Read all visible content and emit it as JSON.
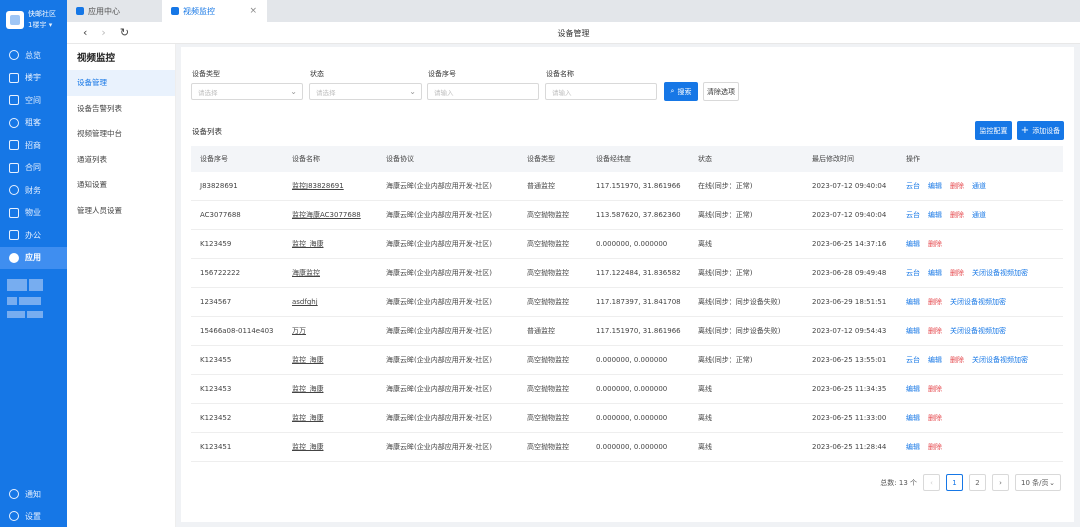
{
  "org": {
    "name": "快邮社区",
    "sub": "1楼宇"
  },
  "nav": [
    {
      "label": "总览",
      "icon": "clock-icon"
    },
    {
      "label": "楼宇",
      "icon": "building-icon"
    },
    {
      "label": "空间",
      "icon": "cube-icon"
    },
    {
      "label": "租客",
      "icon": "people-icon"
    },
    {
      "label": "招商",
      "icon": "target-icon"
    },
    {
      "label": "合同",
      "icon": "document-icon"
    },
    {
      "label": "财务",
      "icon": "money-icon"
    },
    {
      "label": "物业",
      "icon": "home-icon"
    },
    {
      "label": "办公",
      "icon": "monitor-icon"
    },
    {
      "label": "应用",
      "icon": "apps-icon"
    }
  ],
  "nav_bottom": [
    {
      "label": "通知",
      "icon": "bell-icon"
    },
    {
      "label": "设置",
      "icon": "menu-icon"
    }
  ],
  "tabs": [
    {
      "label": "应用中心"
    },
    {
      "label": "视频监控"
    }
  ],
  "titlebar": {
    "title": "设备管理"
  },
  "subnav": {
    "title": "视频监控",
    "items": [
      "设备管理",
      "设备告警列表",
      "视频管理中台",
      "通道列表",
      "通知设置",
      "管理人员设置"
    ]
  },
  "filters": {
    "type_label": "设备类型",
    "type_placeholder": "请选择",
    "status_label": "状态",
    "status_placeholder": "请选择",
    "serial_label": "设备序号",
    "serial_placeholder": "请输入",
    "name_label": "设备名称",
    "name_placeholder": "请输入",
    "search_btn": "搜索",
    "clear_btn": "清除选项"
  },
  "list": {
    "title": "设备列表",
    "config_btn": "监控配置",
    "add_btn": "添加设备"
  },
  "table": {
    "columns": [
      "设备序号",
      "设备名称",
      "设备协议",
      "设备类型",
      "设备经纬度",
      "状态",
      "最后修改时间",
      "操作"
    ],
    "rows": [
      {
        "serial": "J83828691",
        "name": "监控J83828691",
        "protocol": "海康云眸(企业内部应用开发-社区)",
        "type": "普通监控",
        "coords": "117.151970, 31.861966",
        "status": "在线(同步：正常)",
        "time": "2023-07-12 09:40:04",
        "ops": [
          "云台",
          "编辑",
          "删除",
          "通道"
        ]
      },
      {
        "serial": "AC3077688",
        "name": "监控海康AC3077688",
        "protocol": "海康云眸(企业内部应用开发-社区)",
        "type": "高空抛物监控",
        "coords": "113.587620, 37.862360",
        "status": "离线(同步：正常)",
        "time": "2023-07-12 09:40:04",
        "ops": [
          "云台",
          "编辑",
          "删除",
          "通道"
        ]
      },
      {
        "serial": "K123459",
        "name": "监控_海康",
        "protocol": "海康云眸(企业内部应用开发-社区)",
        "type": "高空抛物监控",
        "coords": "0.000000, 0.000000",
        "status": "离线",
        "time": "2023-06-25 14:37:16",
        "ops": [
          "编辑",
          "删除"
        ]
      },
      {
        "serial": "156722222",
        "name": "海康监控",
        "protocol": "海康云眸(企业内部应用开发-社区)",
        "type": "高空抛物监控",
        "coords": "117.122484, 31.836582",
        "status": "离线(同步：正常)",
        "time": "2023-06-28 09:49:48",
        "ops": [
          "云台",
          "编辑",
          "删除",
          "关闭设备视频加密"
        ]
      },
      {
        "serial": "1234567",
        "name": "asdfghj",
        "protocol": "海康云眸(企业内部应用开发-社区)",
        "type": "高空抛物监控",
        "coords": "117.187397, 31.841708",
        "status": "离线(同步：同步设备失败)",
        "time": "2023-06-29 18:51:51",
        "ops": [
          "编辑",
          "删除",
          "关闭设备视频加密"
        ]
      },
      {
        "serial": "15466a08-0114e403",
        "name": "万万",
        "protocol": "海康云眸(企业内部应用开发-社区)",
        "type": "普通监控",
        "coords": "117.151970, 31.861966",
        "status": "离线(同步：同步设备失败)",
        "time": "2023-07-12 09:54:43",
        "ops": [
          "编辑",
          "删除",
          "关闭设备视频加密"
        ]
      },
      {
        "serial": "K123455",
        "name": "监控_海康",
        "protocol": "海康云眸(企业内部应用开发-社区)",
        "type": "高空抛物监控",
        "coords": "0.000000, 0.000000",
        "status": "离线(同步：正常)",
        "time": "2023-06-25 13:55:01",
        "ops": [
          "云台",
          "编辑",
          "删除",
          "关闭设备视频加密"
        ]
      },
      {
        "serial": "K123453",
        "name": "监控_海康",
        "protocol": "海康云眸(企业内部应用开发-社区)",
        "type": "高空抛物监控",
        "coords": "0.000000, 0.000000",
        "status": "离线",
        "time": "2023-06-25 11:34:35",
        "ops": [
          "编辑",
          "删除"
        ]
      },
      {
        "serial": "K123452",
        "name": "监控_海康",
        "protocol": "海康云眸(企业内部应用开发-社区)",
        "type": "高空抛物监控",
        "coords": "0.000000, 0.000000",
        "status": "离线",
        "time": "2023-06-25 11:33:00",
        "ops": [
          "编辑",
          "删除"
        ]
      },
      {
        "serial": "K123451",
        "name": "监控_海康",
        "protocol": "海康云眸(企业内部应用开发-社区)",
        "type": "高空抛物监控",
        "coords": "0.000000, 0.000000",
        "status": "离线",
        "time": "2023-06-25 11:28:44",
        "ops": [
          "编辑",
          "删除"
        ]
      }
    ]
  },
  "pagination": {
    "total": "总数: 13 个",
    "pages": [
      "1",
      "2"
    ],
    "current": "1",
    "page_size": "10 条/页"
  },
  "colors": {
    "primary": "#1677e6",
    "danger": "#e5484d",
    "sidebar": "#1677e6"
  }
}
